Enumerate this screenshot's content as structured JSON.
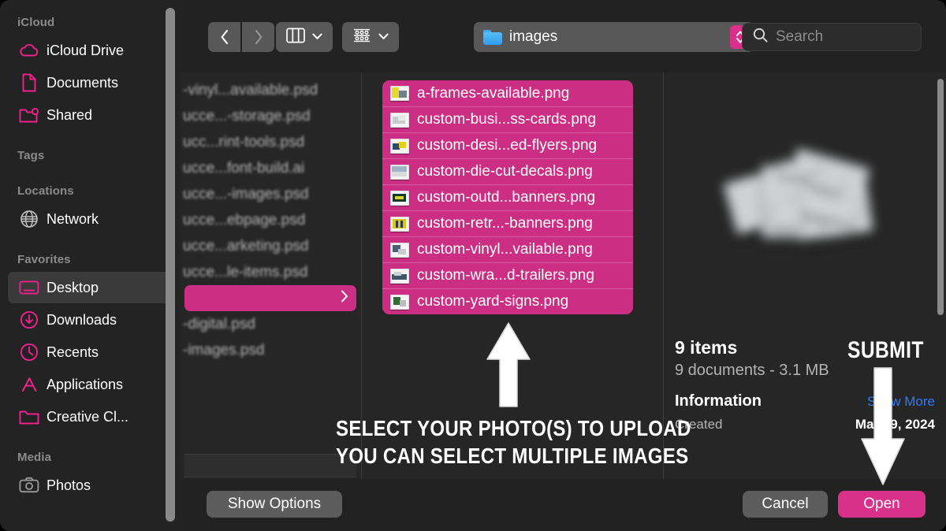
{
  "window": {
    "title": "images"
  },
  "sidebar": {
    "sections": [
      {
        "title": "iCloud",
        "items": [
          {
            "label": "iCloud Drive",
            "icon": "cloud-icon"
          },
          {
            "label": "Documents",
            "icon": "document-icon"
          },
          {
            "label": "Shared",
            "icon": "shared-folder-icon"
          }
        ]
      },
      {
        "title": "Tags",
        "items": []
      },
      {
        "title": "Locations",
        "items": [
          {
            "label": "Network",
            "icon": "globe-icon"
          }
        ]
      },
      {
        "title": "Favorites",
        "items": [
          {
            "label": "Desktop",
            "icon": "desktop-icon",
            "selected": true
          },
          {
            "label": "Downloads",
            "icon": "download-icon"
          },
          {
            "label": "Recents",
            "icon": "clock-icon"
          },
          {
            "label": "Applications",
            "icon": "applications-icon"
          },
          {
            "label": "Creative Cl...",
            "icon": "folder-icon"
          }
        ]
      },
      {
        "title": "Media",
        "items": [
          {
            "label": "Photos",
            "icon": "camera-icon"
          }
        ]
      }
    ]
  },
  "toolbar": {
    "back_icon": "chevron-left-icon",
    "forward_icon": "chevron-right-icon",
    "view_icon": "column-view-icon",
    "view_chevron": "chevron-down-icon",
    "group_icon": "group-by-icon",
    "group_chevron": "chevron-down-icon",
    "path_folder_icon": "folder-icon",
    "path_label": "images",
    "stepper_icon": "up-down-stepper-icon",
    "search_icon": "search-icon",
    "search_placeholder": "Search",
    "search_value": ""
  },
  "columns": {
    "column_one": {
      "items": [
        {
          "name": "-vinyl...available.psd"
        },
        {
          "name": "ucce...-storage.psd"
        },
        {
          "name": "ucc...rint-tools.psd"
        },
        {
          "name": "ucce...font-build.ai"
        },
        {
          "name": "ucce...-images.psd"
        },
        {
          "name": "ucce...ebpage.psd"
        },
        {
          "name": "ucce...arketing.psd"
        },
        {
          "name": "ucce...le-items.psd"
        },
        {
          "name": "",
          "selected": true,
          "disclosure": "chevron-right-icon"
        },
        {
          "name": "-digital.psd"
        },
        {
          "name": "-images.psd"
        }
      ]
    },
    "column_two": {
      "files": [
        {
          "name": "a-frames-available.png",
          "icon": "image-thumbnail-icon"
        },
        {
          "name": "custom-busi...ss-cards.png",
          "icon": "image-thumbnail-icon"
        },
        {
          "name": "custom-desi...ed-flyers.png",
          "icon": "image-thumbnail-icon"
        },
        {
          "name": "custom-die-cut-decals.png",
          "icon": "image-thumbnail-icon"
        },
        {
          "name": "custom-outd...banners.png",
          "icon": "image-thumbnail-icon"
        },
        {
          "name": "custom-retr...-banners.png",
          "icon": "image-thumbnail-icon"
        },
        {
          "name": "custom-vinyl...vailable.png",
          "icon": "image-thumbnail-icon"
        },
        {
          "name": "custom-wra...d-trailers.png",
          "icon": "image-thumbnail-icon"
        },
        {
          "name": "custom-yard-signs.png",
          "icon": "image-thumbnail-icon"
        }
      ]
    },
    "preview": {
      "thumbnail_icon": "stacked-images-preview",
      "item_count": "9 items",
      "size_line": "9 documents - 3.1 MB",
      "info_title": "Information",
      "show_more": "Show More",
      "created_label": "Created",
      "created_value": "Mar 19, 2024"
    }
  },
  "footer": {
    "show_options": "Show Options",
    "cancel": "Cancel",
    "open": "Open"
  },
  "overlay": {
    "submit_label": "SUBMIT",
    "instruction_line1": "SELECT YOUR PHOTO(S) TO UPLOAD",
    "instruction_line2": "YOU CAN SELECT MULTIPLE IMAGES",
    "arrow_up_icon": "arrow-up-icon",
    "arrow_down_icon": "arrow-down-icon"
  },
  "colors": {
    "accent_pink": "#d9318a",
    "selection_pink": "#cc2e84",
    "link_blue": "#2f7cf6",
    "window_bg": "#222222",
    "sidebar_bg": "#232323"
  }
}
